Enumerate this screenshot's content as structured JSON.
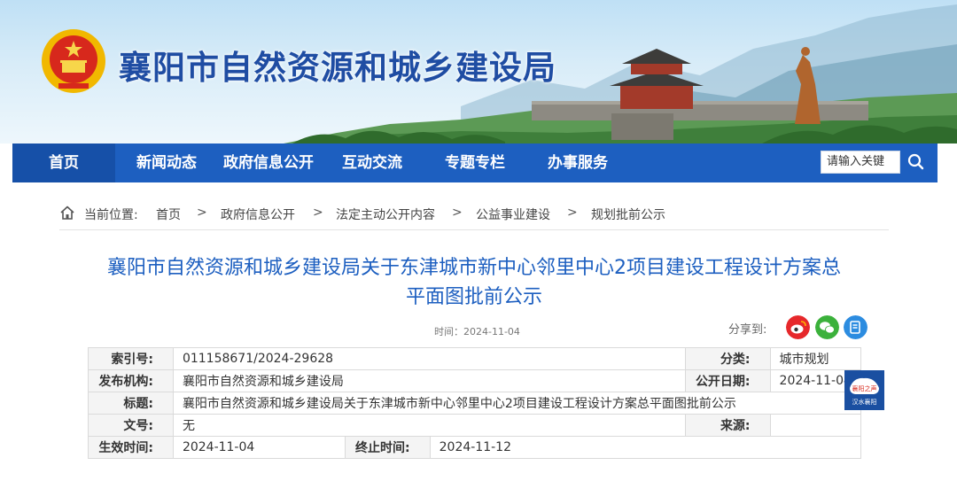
{
  "header": {
    "site_title": "襄阳市自然资源和城乡建设局",
    "colors": {
      "brand_blue": "#1d5fc0",
      "nav_active": "#1650a8",
      "title_blue": "#1f4da3"
    }
  },
  "nav": {
    "items": [
      {
        "label": "首页",
        "active": true
      },
      {
        "label": "新闻动态"
      },
      {
        "label": "政府信息公开"
      },
      {
        "label": "互动交流"
      },
      {
        "label": "专题专栏"
      },
      {
        "label": "办事服务"
      }
    ],
    "search_placeholder": "请输入关键",
    "search_icon": "search-icon"
  },
  "breadcrumb": {
    "prefix": "当前位置:",
    "items": [
      "首页",
      "政府信息公开",
      "法定主动公开内容",
      "公益事业建设",
      "规划批前公示"
    ],
    "separator": ">"
  },
  "article": {
    "title_line1": "襄阳市自然资源和城乡建设局关于东津城市新中心邻里中心2项目建设工程设计方案总",
    "title_line2": "平面图批前公示",
    "time": "时间：2024-11-04",
    "share_label": "分享到:",
    "share_icons": [
      "weibo-icon",
      "wechat-icon",
      "copy-link-icon"
    ]
  },
  "info_table": {
    "index_label": "索引号:",
    "index_value": "011158671/2024-29628",
    "category_label": "分类:",
    "category_value": "城市规划",
    "publisher_label": "发布机构:",
    "publisher_value": "襄阳市自然资源和城乡建设局",
    "pubdate_label": "公开日期:",
    "pubdate_value": "2024-11-04",
    "title_label": "标题:",
    "title_value": "襄阳市自然资源和城乡建设局关于东津城市新中心邻里中心2项目建设工程设计方案总平面图批前公示",
    "docno_label": "文号:",
    "docno_value": "无",
    "source_label": "来源:",
    "source_value": "",
    "effective_label": "生效时间:",
    "effective_value": "2024-11-04",
    "expire_label": "终止时间:",
    "expire_value": "2024-11-12"
  },
  "float_widget": {
    "line1": "襄阳之声",
    "line2": "汉水襄阳"
  }
}
